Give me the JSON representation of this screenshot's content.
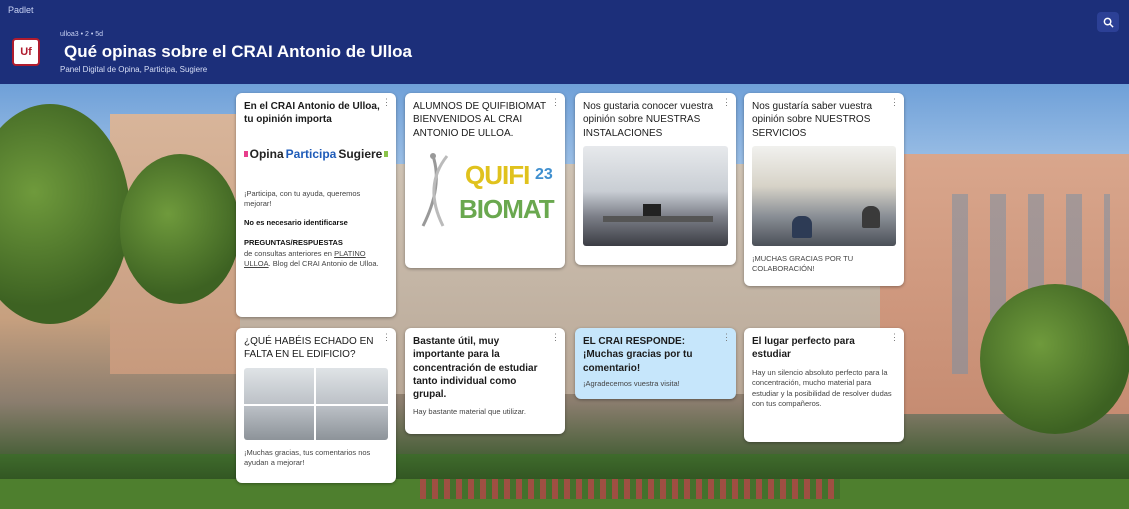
{
  "app": {
    "brand": "Padlet"
  },
  "board": {
    "meta": "ulloa3 • 2 • 5d",
    "title": "Qué opinas sobre el CRAI Antonio de Ulloa",
    "subtitle": "Panel Digital de Opina, Participa, Sugiere"
  },
  "cards": [
    {
      "title": "En el CRAI Antonio de Ulloa, tu opinión importa",
      "logo": {
        "w1": "Opina",
        "w2": "Participa",
        "w3": "Sugiere"
      },
      "p1": "¡Participa, con tu ayuda, queremos mejorar!",
      "p2": "No es necesario identificarse",
      "p3_title": "PREGUNTAS/RESPUESTAS",
      "p3_a": "de consultas anteriores en",
      "p3_link": "PLATINO ULLOA",
      "p3_b": ". Blog del CRAI Antonio de Ulloa."
    },
    {
      "title": "ALUMNOS DE QUIFIBIOMAT BIENVENIDOS AL CRAI ANTONIO DE ULLOA.",
      "logo_a": "QUIFI",
      "logo_b": "BIOMAT",
      "logo_c": "23"
    },
    {
      "title": "Nos gustaria conocer vuestra opinión sobre NUESTRAS INSTALACIONES"
    },
    {
      "title": "Nos gustaría saber vuestra opinión sobre NUESTROS SERVICIOS",
      "body": "¡MUCHAS GRACIAS POR TU COLABORACIÓN!"
    },
    {
      "title": "¿QUÉ HABÉIS ECHADO EN FALTA EN EL EDIFICIO?",
      "body": "¡Muchas gracias, tus comentarios nos ayudan a mejorar!"
    },
    {
      "title": "Bastante útil, muy importante para la concentración de estudiar tanto individual como grupal.",
      "body": "Hay bastante material que utilizar."
    },
    {
      "title": "EL CRAI RESPONDE: ¡Muchas gracias por tu comentario!",
      "body": "¡Agradecemos vuestra visita!"
    },
    {
      "title": "El lugar perfecto para estudiar",
      "body": "Hay un silencio absoluto perfecto para la concentración, mucho material para estudiar y la posibilidad de resolver dudas con tus compañeros."
    }
  ],
  "colors": {
    "header": "#1c2f7a",
    "accent_blue_card": "#c6e6fb"
  },
  "icons": {
    "search": "search-icon",
    "menu": "more-vertical-icon"
  }
}
